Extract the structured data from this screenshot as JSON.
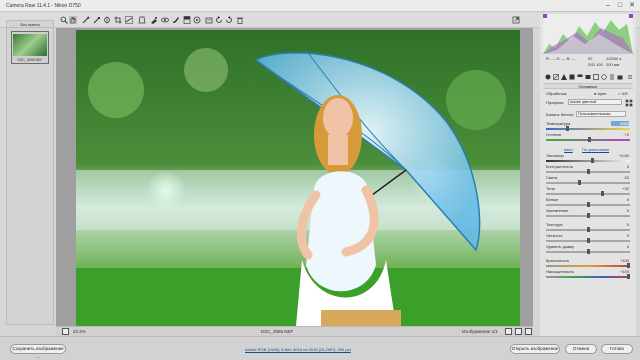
{
  "window": {
    "title": "Camera Raw 11.4.1  -  Nikon D750"
  },
  "filmstrip": {
    "header": "Без имени",
    "thumb_caption": "DSC_3095.NEF"
  },
  "statusbar": {
    "zoom": "22.2%",
    "filename": "DSC_3095.NEF",
    "image_count": "Изображение 1/1"
  },
  "histogram": {
    "f": "f/2",
    "shutter": "1/2000 s",
    "iso": "ISO 100",
    "focal": "200 мм",
    "rgb": "R: ---  G: ---  B: ---"
  },
  "panel": {
    "section_title": "Основные",
    "treatment_label": "Обработка:",
    "treatment_color": "Цвет",
    "treatment_bw": "Ч/б",
    "profile_label": "Профиль:",
    "profile_value": "Adobe цветной",
    "wb_label": "Баланс белого:",
    "wb_value": "Пользовательская",
    "auto_link": "Авто",
    "default_link": "По умолчанию",
    "sliders": [
      {
        "label": "Температура",
        "value": "4885"
      },
      {
        "label": "Оттенок",
        "value": "+2"
      },
      {
        "label": "Экспонир",
        "value": "+0,60"
      },
      {
        "label": "Контрастность",
        "value": "0"
      },
      {
        "label": "Света",
        "value": "-22"
      },
      {
        "label": "Тени",
        "value": "+32"
      },
      {
        "label": "Белые",
        "value": "0"
      },
      {
        "label": "Затемнение",
        "value": "0"
      },
      {
        "label": "Текстура",
        "value": "0"
      },
      {
        "label": "Четкость",
        "value": "0"
      },
      {
        "label": "Удалить дымку",
        "value": "0"
      },
      {
        "label": "Красочность",
        "value": "+100"
      },
      {
        "label": "Насыщенность",
        "value": "+100"
      }
    ]
  },
  "bottombar": {
    "save_label": "Сохранить изображение ...",
    "info_link": "Adobe RGB (1998); 8 бит; 6016 на 4016 (24,2МП); 300 ppi",
    "open_label": "Открыть изображение",
    "cancel_label": "Отмена",
    "done_label": "Готово"
  }
}
